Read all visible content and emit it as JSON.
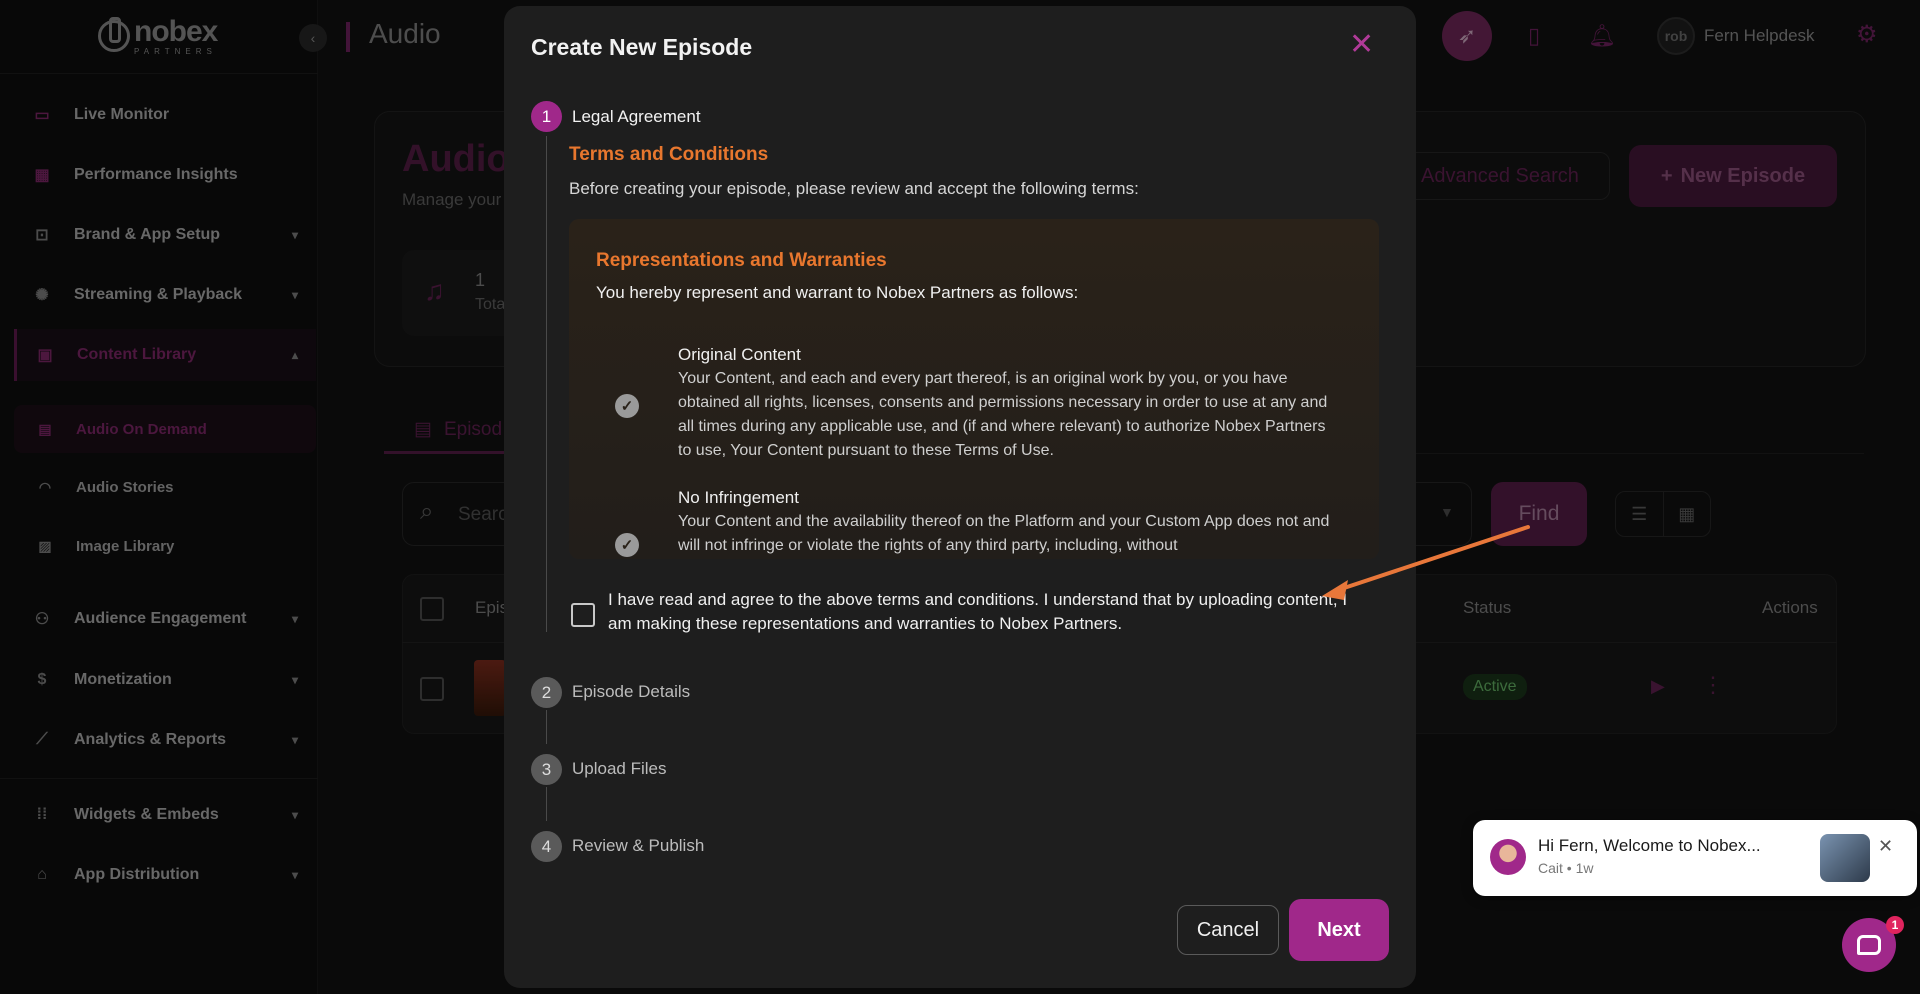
{
  "app": {
    "logo_main": "nobex",
    "logo_sub": "PARTNERS",
    "page_title": "Audio",
    "user_name": "Fern Helpdesk",
    "user_avatar_text": "rob"
  },
  "sidebar": {
    "items": [
      {
        "label": "Live Monitor",
        "icon": "monitor-icon"
      },
      {
        "label": "Performance Insights",
        "icon": "dashboard-icon"
      },
      {
        "label": "Brand & App Setup",
        "icon": "app-setup-icon"
      },
      {
        "label": "Streaming & Playback",
        "icon": "streaming-icon"
      },
      {
        "label": "Content Library",
        "icon": "library-icon"
      },
      {
        "label": "Audience Engagement",
        "icon": "people-icon"
      },
      {
        "label": "Monetization",
        "icon": "dollar-icon"
      },
      {
        "label": "Analytics & Reports",
        "icon": "chart-icon"
      },
      {
        "label": "Widgets & Embeds",
        "icon": "grid-icon"
      },
      {
        "label": "App Distribution",
        "icon": "store-icon"
      }
    ],
    "sub_items": [
      {
        "label": "Audio On Demand",
        "icon": "file-audio-icon"
      },
      {
        "label": "Audio Stories",
        "icon": "headphones-icon"
      },
      {
        "label": "Image Library",
        "icon": "image-icon"
      }
    ]
  },
  "background": {
    "title": "Audio",
    "subtitle": "Manage your",
    "stat_value": "1",
    "stat_label": "Tota",
    "advanced_search": "Advanced Search",
    "new_episode": "New Episode",
    "tab_label": "Episod",
    "search_placeholder": "Searc",
    "find": "Find",
    "col_episode": "Epis",
    "col_status": "Status",
    "col_actions": "Actions",
    "row_status": "Active"
  },
  "modal": {
    "title": "Create New Episode",
    "steps": [
      {
        "num": "1",
        "label": "Legal Agreement"
      },
      {
        "num": "2",
        "label": "Episode Details"
      },
      {
        "num": "3",
        "label": "Upload Files"
      },
      {
        "num": "4",
        "label": "Review & Publish"
      }
    ],
    "terms_title": "Terms and Conditions",
    "terms_intro": "Before creating your episode, please review and accept the following terms:",
    "rw_title": "Representations and Warranties",
    "rw_intro": "You hereby represent and warrant to Nobex Partners as follows:",
    "rw_items": [
      {
        "heading": "Original Content",
        "body": "Your Content, and each and every part thereof, is an original work by you, or you have obtained all rights, licenses, consents and permissions necessary in order to use at any and all times during any applicable use, and (if and where relevant) to authorize Nobex Partners to use, Your Content pursuant to these Terms of Use."
      },
      {
        "heading": "No Infringement",
        "body": "Your Content and the availability thereof on the Platform and your Custom App does not and will not infringe or violate the rights of any third party, including, without"
      }
    ],
    "agree_text": "I have read and agree to the above terms and conditions. I understand that by uploading content, I am making these representations and warranties to Nobex Partners.",
    "cancel": "Cancel",
    "next": "Next"
  },
  "chat": {
    "message": "Hi Fern, Welcome to Nobex...",
    "meta": "Cait • 1w",
    "badge": "1"
  },
  "colors": {
    "accent": "#a0288a",
    "orange": "#e8772e",
    "active_green": "#6ec46e"
  }
}
